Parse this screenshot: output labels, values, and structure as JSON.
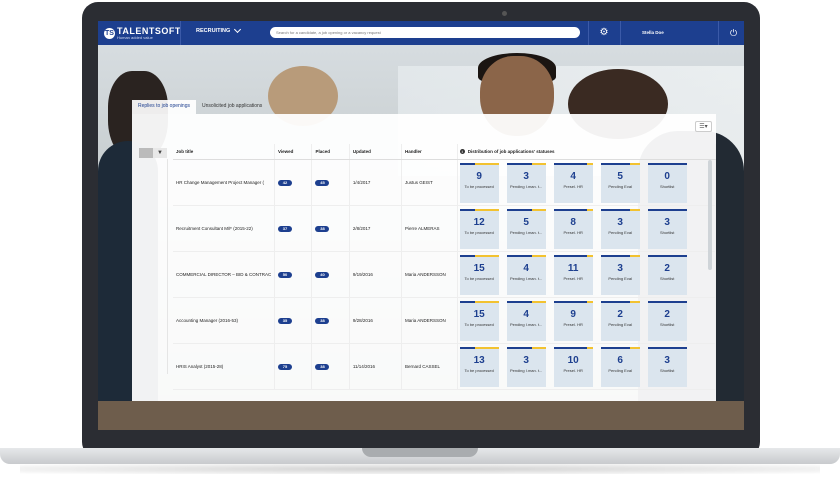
{
  "app": {
    "brand": "TALENTSOFT",
    "brand_badge": "TS",
    "tagline": "Human added value",
    "module": "RECRUITING",
    "search_placeholder": "Search for a candidate, a job opening or a vacancy request",
    "user_name": "Stella Doe"
  },
  "tabs": [
    {
      "label": "Replies to job openings",
      "active": true
    },
    {
      "label": "Unsolicited job applications",
      "active": false
    }
  ],
  "table": {
    "headers": {
      "title": "Job title",
      "viewed": "Viewed",
      "placed": "Placed",
      "updated": "Updated",
      "handler": "Handler",
      "distribution": "Distribution of job applications' statuses"
    },
    "status_labels": [
      "To be processed",
      "Pending I.man. t...",
      "Presel. HR",
      "Pending Eval",
      "Shortlist"
    ],
    "rows": [
      {
        "title": "HR Change Management Project Manager (",
        "viewed": "42",
        "placed": "45",
        "updated": "1/4/2017",
        "handler": "Justus GEIST",
        "counts": [
          "9",
          "3",
          "4",
          "5",
          "0"
        ]
      },
      {
        "title": "Recruitment Consultant M/F (2015-22)",
        "viewed": "37",
        "placed": "38",
        "updated": "2/8/2017",
        "handler": "Pierre ALMERAS",
        "counts": [
          "12",
          "5",
          "8",
          "3",
          "3"
        ]
      },
      {
        "title": "COMMERCIAL DIRECTOR – BID & CONTRAC",
        "viewed": "50",
        "placed": "40",
        "updated": "9/19/2016",
        "handler": "Maria ANDERSSON",
        "counts": [
          "15",
          "4",
          "11",
          "3",
          "2"
        ]
      },
      {
        "title": "Accounting Manager (2016-53)",
        "viewed": "35",
        "placed": "38",
        "updated": "9/28/2016",
        "handler": "Maria ANDERSSON",
        "counts": [
          "15",
          "4",
          "9",
          "2",
          "2"
        ]
      },
      {
        "title": "HRIS Analyst (2015-28)",
        "viewed": "75",
        "placed": "38",
        "updated": "11/14/2016",
        "handler": "Bernard CASSEL",
        "counts": [
          "13",
          "3",
          "10",
          "6",
          "3"
        ]
      }
    ]
  }
}
